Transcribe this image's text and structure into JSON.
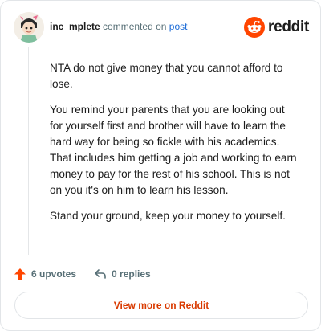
{
  "comment": {
    "username": "inc_mplete",
    "action_text": "commented on",
    "post_link": "post",
    "paragraphs": [
      "NTA do not give money that you cannot afford to lose.",
      "You remind your parents that you are looking out for yourself first and brother will have to learn the hard way for being so fickle with his academics. That includes him getting a job and working to earn money to pay for the rest of his school. This is not on you it's on him to learn his lesson.",
      "Stand your ground, keep your money to yourself."
    ],
    "upvotes": "6 upvotes",
    "replies": "0 replies"
  },
  "brand": {
    "name": "reddit",
    "color": "#ff4500",
    "icon": "reddit-logo-icon"
  },
  "footer": {
    "view_more": "View more on Reddit"
  },
  "colors": {
    "accent": "#d93a00",
    "link": "#1a6ad6",
    "upvote": "#ff4500"
  }
}
